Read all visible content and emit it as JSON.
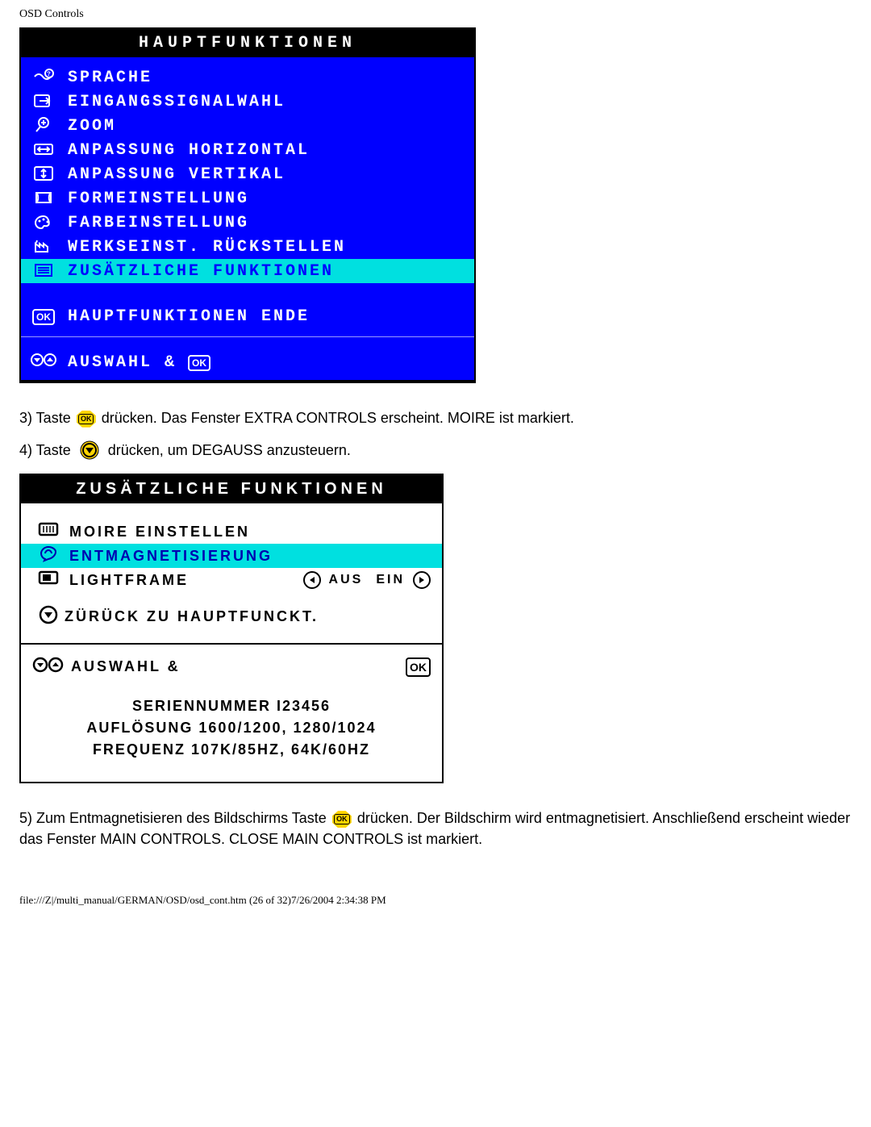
{
  "header": {
    "title": "OSD Controls"
  },
  "osd1": {
    "title": "HAUPTFUNKTIONEN",
    "items": [
      {
        "label": "SPRACHE"
      },
      {
        "label": "EINGANGSSIGNALWAHL"
      },
      {
        "label": "ZOOM"
      },
      {
        "label": "ANPASSUNG HORIZONTAL"
      },
      {
        "label": "ANPASSUNG VERTIKAL"
      },
      {
        "label": "FORMEINSTELLUNG"
      },
      {
        "label": "FARBEINSTELLUNG"
      },
      {
        "label": "WERKSEINST. RÜCKSTELLEN"
      },
      {
        "label": "ZUSÄTZLICHE FUNKTIONEN"
      }
    ],
    "close": "HAUPTFUNKTIONEN ENDE",
    "footer": "AUSWAHL &",
    "ok": "OK"
  },
  "step3": {
    "prefix": "3) Taste ",
    "suffix": " drücken. Das Fenster EXTRA CONTROLS erscheint. MOIRE ist markiert."
  },
  "step4": {
    "prefix": "4) Taste ",
    "suffix": " drücken, um DEGAUSS anzusteuern."
  },
  "osd2": {
    "title": "ZUSÄTZLICHE FUNKTIONEN",
    "items": [
      {
        "label": "MOIRE EINSTELLEN"
      },
      {
        "label": "ENTMAGNETISIERUNG"
      },
      {
        "label": "LIGHTFRAME",
        "opt_off": "AUS",
        "opt_on": "EIN"
      }
    ],
    "back": "ZÜRÜCK ZU HAUPTFUNCKT.",
    "footer": "AUSWAHL &",
    "ok": "OK",
    "serial_label": "SERIENNUMMER",
    "serial": "I23456",
    "res_label": "AUFLÖSUNG",
    "res": "1600/1200, 1280/1024",
    "freq_label": "FREQUENZ",
    "freq": "107K/85HZ, 64K/60HZ"
  },
  "step5": {
    "prefix": "5) Zum Entmagnetisieren des Bildschirms Taste ",
    "suffix": " drücken. Der Bildschirm wird entmagnetisiert. Anschließend erscheint wieder das Fenster MAIN CONTROLS. CLOSE MAIN CONTROLS ist markiert."
  },
  "footer": {
    "text": "file:///Z|/multi_manual/GERMAN/OSD/osd_cont.htm (26 of 32)7/26/2004 2:34:38 PM"
  }
}
